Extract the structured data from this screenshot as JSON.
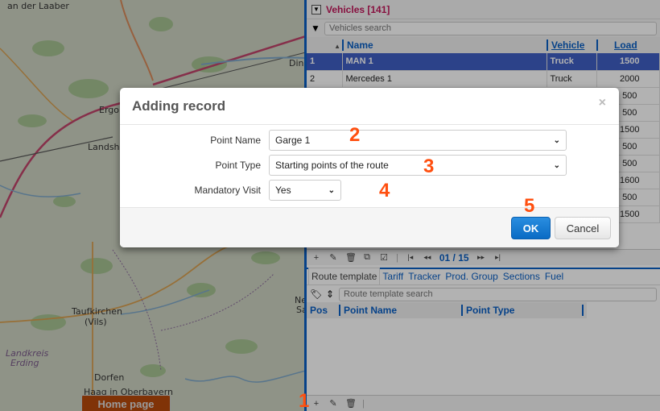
{
  "map": {
    "labels": {
      "an_der_laaber": "an der Laaber",
      "ding": "Ding",
      "ergol": "Ergol",
      "landshut": "Landshu",
      "taufkirchen": "Taufkirchen",
      "vils": "(Vils)",
      "landkreis": "Landkreis",
      "erding": "Erding",
      "dorfen": "Dorfen",
      "haag": "Haag in Oberbayern",
      "ne": "Ne",
      "sa": "Sa"
    },
    "home_button": "Home page"
  },
  "vehicles_panel": {
    "title": "Vehicles [141]",
    "search_placeholder": "Vehicles search",
    "columns": [
      "Name",
      "Vehicle",
      "Load"
    ],
    "rows": [
      {
        "num": "1",
        "name": "MAN 1",
        "vehicle": "Truck",
        "load": "1500",
        "selected": true
      },
      {
        "num": "2",
        "name": "Mercedes 1",
        "vehicle": "Truck",
        "load": "2000"
      },
      {
        "num": "",
        "name": "",
        "vehicle": "",
        "load": "500"
      },
      {
        "num": "",
        "name": "",
        "vehicle": "",
        "load": "500"
      },
      {
        "num": "",
        "name": "",
        "vehicle": "",
        "load": "1500"
      },
      {
        "num": "",
        "name": "",
        "vehicle": "",
        "load": "500"
      },
      {
        "num": "",
        "name": "",
        "vehicle": "",
        "load": "500"
      },
      {
        "num": "",
        "name": "",
        "vehicle": "",
        "load": "1600"
      },
      {
        "num": "",
        "name": "",
        "vehicle": "",
        "load": "500"
      },
      {
        "num": "",
        "name": "",
        "vehicle": "",
        "load": "1500"
      }
    ],
    "pager": "01 / 15"
  },
  "detail_panel": {
    "tabs": [
      "Route template",
      "Tariff",
      "Tracker",
      "Prod. Group",
      "Sections",
      "Fuel"
    ],
    "active_tab": "Route template",
    "search_placeholder": "Route template search",
    "columns": [
      "Pos",
      "Point Name",
      "Point Type"
    ]
  },
  "modal": {
    "title": "Adding record",
    "close": "×",
    "fields": {
      "point_name": {
        "label": "Point Name",
        "value": "Garge 1"
      },
      "point_type": {
        "label": "Point Type",
        "value": "Starting points of the route"
      },
      "mandatory_visit": {
        "label": "Mandatory Visit",
        "value": "Yes"
      }
    },
    "ok_label": "OK",
    "cancel_label": "Cancel"
  },
  "steps": [
    "1",
    "2",
    "3",
    "4",
    "5"
  ],
  "colors": {
    "accent": "#0a5fc4",
    "title_pink": "#c2185b",
    "step_orange": "#ff4f0f",
    "selected_row": "#3f5fc4",
    "home_button": "#b84a0b"
  }
}
